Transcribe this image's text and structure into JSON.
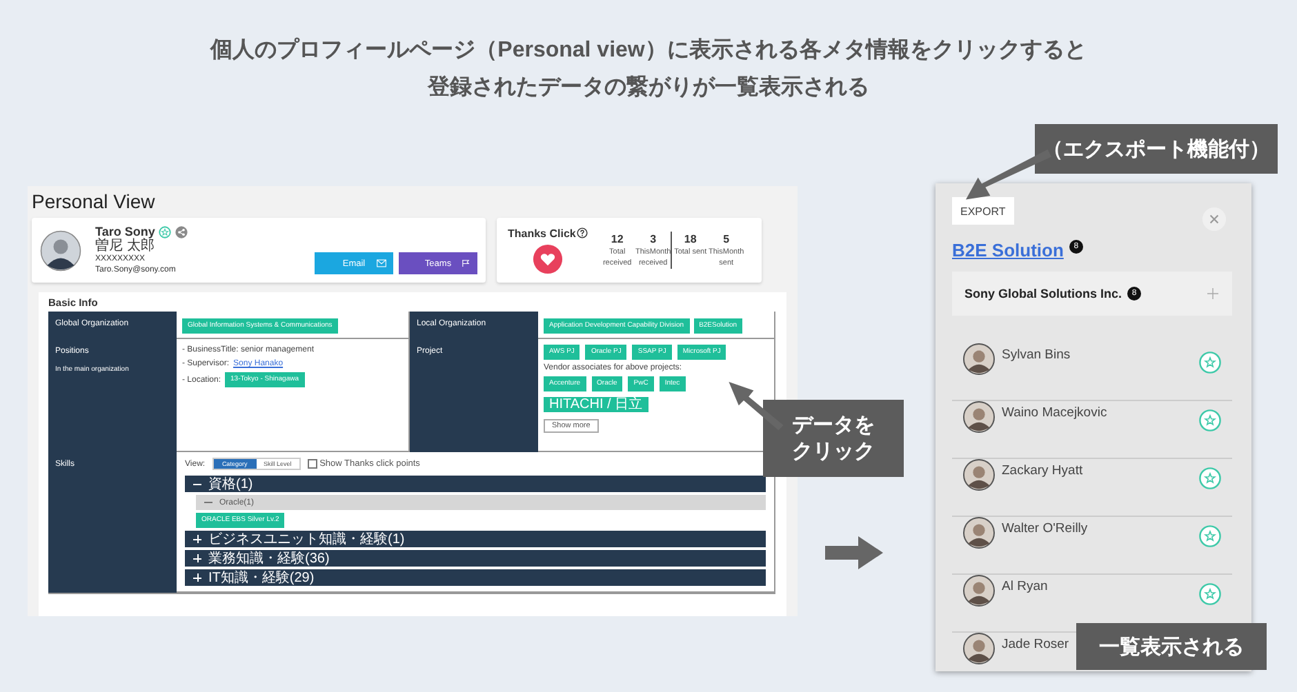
{
  "headline": [
    "個人のプロフィールページ（Personal view）に表示される各メタ情報をクリックすると",
    "登録されたデータの繋がりが一覧表示される"
  ],
  "personal_view": {
    "title": "Personal View",
    "profile": {
      "name": "Taro Sony",
      "name_ja": "曽尼 太郎",
      "id": "XXXXXXXXX",
      "email": "Taro.Sony@sony.com",
      "buttons": [
        {
          "label": "Email",
          "kind": "email"
        },
        {
          "label": "Teams",
          "kind": "teams"
        }
      ]
    },
    "thanks": {
      "title": "Thanks Click",
      "stats": [
        {
          "value": "12",
          "label": "Total received"
        },
        {
          "value": "3",
          "label": "ThisMonth received"
        },
        {
          "value": "18",
          "label": "Total sent"
        },
        {
          "value": "5",
          "label": "ThisMonth sent"
        }
      ]
    },
    "basic_info": {
      "title": "Basic Info",
      "global_org": {
        "label": "Global Organization",
        "tags": [
          "Global Information Systems & Communications"
        ]
      },
      "local_org": {
        "label": "Local Organization",
        "tags": [
          "Application Development Capability Division",
          "B2ESolution"
        ]
      },
      "positions": {
        "label": "Positions",
        "note": "In the main organization",
        "business_title": "- BusinessTitle: senior management",
        "supervisor_label": "- Supervisor:",
        "supervisor": "Sony Hanako",
        "location_label": "- Location:",
        "location": "13-Tokyo - Shinagawa"
      },
      "project": {
        "label": "Project",
        "tags": [
          "AWS PJ",
          "Oracle PJ",
          "SSAP PJ",
          "Microsoft PJ"
        ],
        "vendor_note": "Vendor associates for above projects:",
        "vendors": [
          "Accenture",
          "Oracle",
          "PwC",
          "Intec",
          "HITACHI / 日立"
        ],
        "more": "Show more"
      },
      "skills": {
        "label": "Skills",
        "view_label": "View:",
        "view_options": [
          {
            "label": "Category",
            "selected": true
          },
          {
            "label": "Skill Level",
            "selected": false
          }
        ],
        "show_points": {
          "label": "Show Thanks click points",
          "checked": false
        },
        "tree": [
          {
            "label": "資格(1)",
            "expanded": true,
            "children": [
              {
                "label": "Oracle(1)",
                "expanded": true,
                "tags": [
                  "ORACLE EBS Silver Lv.2"
                ]
              }
            ]
          },
          {
            "label": "ビジネスユニット知識・経験(1)",
            "expanded": false
          },
          {
            "label": "業務知識・経験(36)",
            "expanded": false
          },
          {
            "label": "IT知識・経験(29)",
            "expanded": false
          }
        ]
      }
    }
  },
  "export_panel": {
    "export": "EXPORT",
    "title": "B2E Solution",
    "title_count": "8",
    "group": {
      "name": "Sony Global Solutions Inc.",
      "count": "8"
    },
    "people": [
      "Sylvan Bins",
      "Waino Macejkovic",
      "Zackary Hyatt",
      "Walter O'Reilly",
      "Al Ryan",
      "Jade Roser"
    ]
  },
  "callouts": {
    "export": "（エクスポート機能付）",
    "click": [
      "データを",
      "クリック"
    ],
    "list": "一覧表示される"
  }
}
